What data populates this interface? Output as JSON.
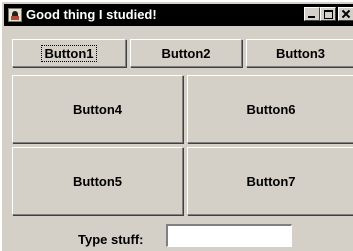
{
  "window": {
    "title": "Good thing I studied!",
    "controls": {
      "minimize_icon": "minimize-icon",
      "maximize_icon": "maximize-icon",
      "close_icon": "close-icon"
    }
  },
  "buttons": {
    "b1": "Button1",
    "b2": "Button2",
    "b3": "Button3",
    "b4": "Button4",
    "b6": "Button6",
    "b5": "Button5",
    "b7": "Button7"
  },
  "input": {
    "label": "Type stuff:",
    "value": ""
  },
  "colors": {
    "titlebar": "#000000",
    "surface": "#d4d0c8",
    "field": "#ffffff"
  }
}
